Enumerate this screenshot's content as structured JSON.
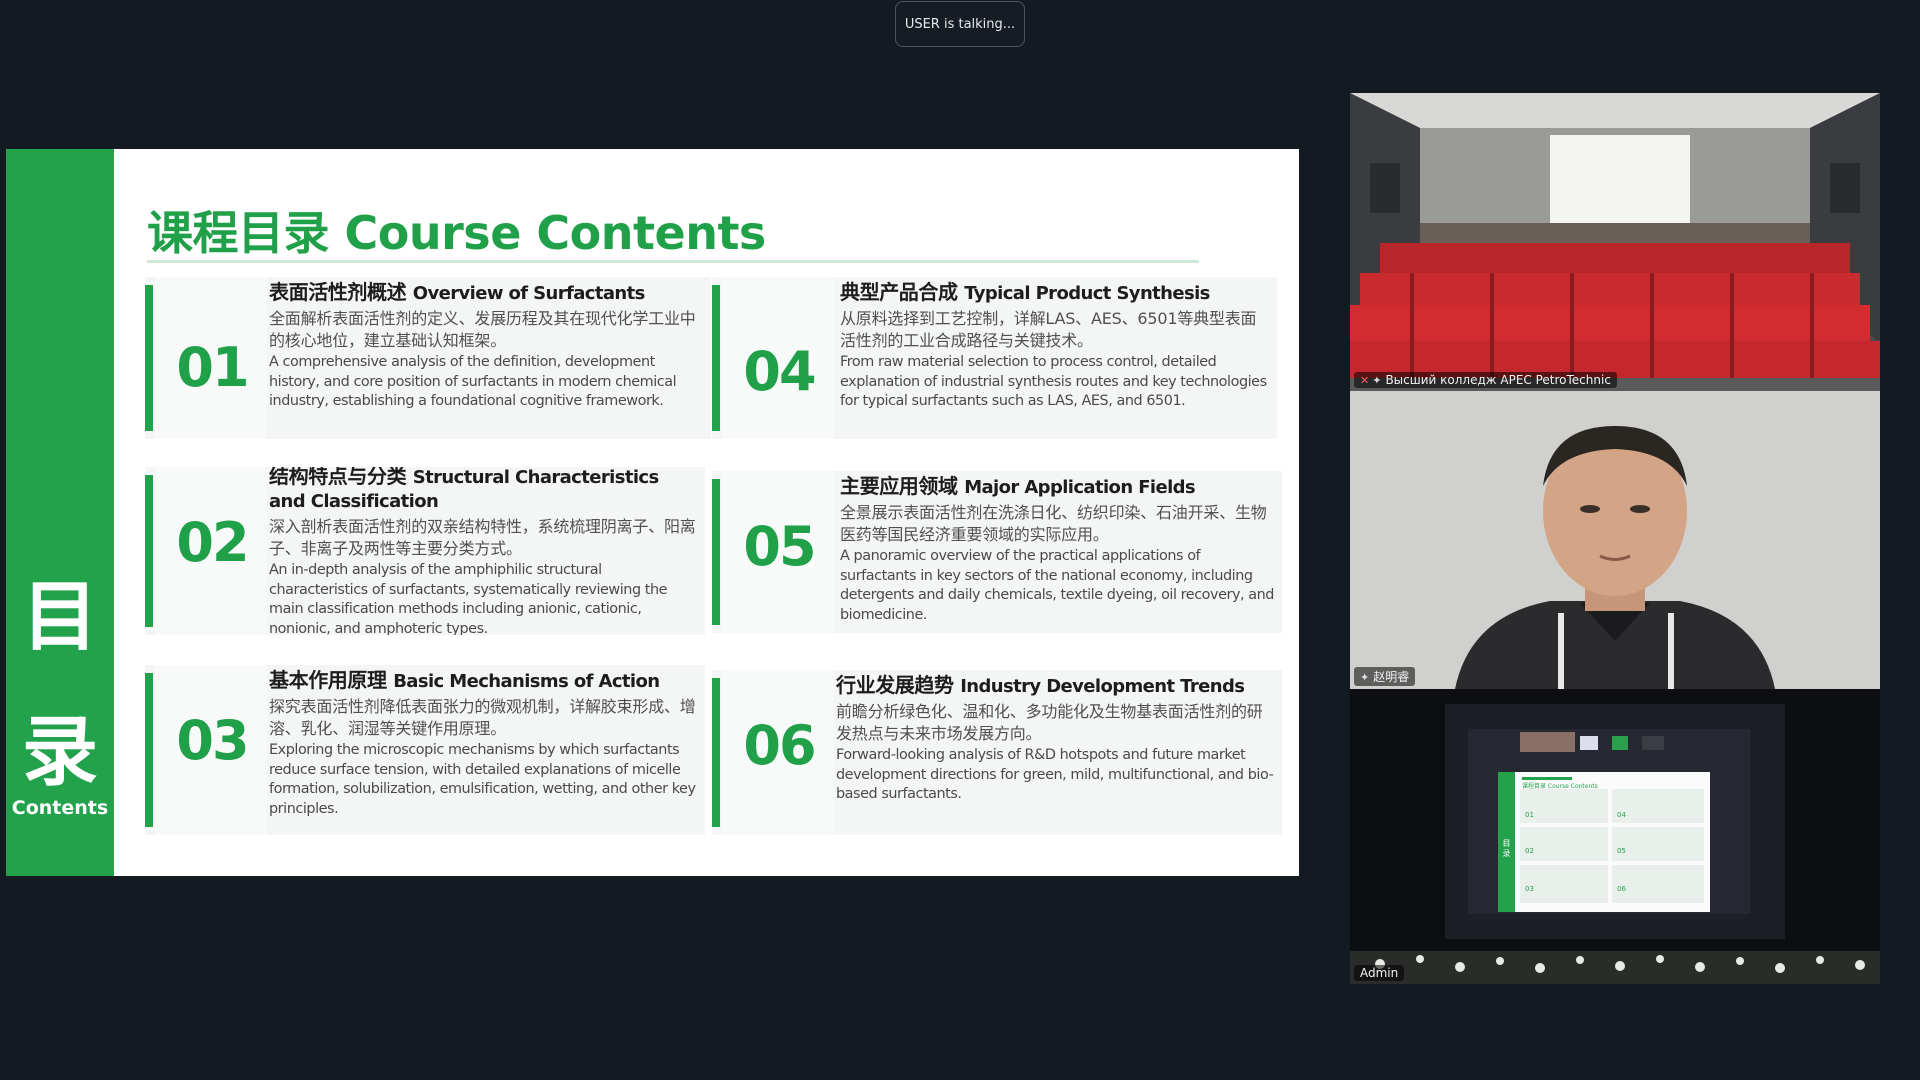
{
  "status": {
    "talking": "USER is talking..."
  },
  "slide": {
    "side_char_1": "目",
    "side_char_2": "录",
    "side_label": "Contents",
    "title": "课程目录 Course Contents",
    "items": [
      {
        "num": "01",
        "title_zh": "表面活性剂概述",
        "title_en": "Overview of Surfactants",
        "desc_zh": "全面解析表面活性剂的定义、发展历程及其在现代化学工业中的核心地位，建立基础认知框架。",
        "desc_en": "A comprehensive analysis of the definition, development history, and core position of surfactants in modern chemical industry, establishing a foundational cognitive framework."
      },
      {
        "num": "02",
        "title_zh": "结构特点与分类",
        "title_en": "Structural Characteristics and Classification",
        "desc_zh": "深入剖析表面活性剂的双亲结构特性，系统梳理阴离子、阳离子、非离子及两性等主要分类方式。",
        "desc_en": "An in-depth analysis of the amphiphilic structural characteristics of surfactants, systematically reviewing the main classification methods including anionic, cationic, nonionic, and amphoteric types."
      },
      {
        "num": "03",
        "title_zh": "基本作用原理",
        "title_en": "Basic Mechanisms of Action",
        "desc_zh": "探究表面活性剂降低表面张力的微观机制，详解胶束形成、增溶、乳化、润湿等关键作用原理。",
        "desc_en": "Exploring the microscopic mechanisms by which surfactants reduce surface tension, with detailed explanations of micelle formation, solubilization, emulsification, wetting, and other key principles."
      },
      {
        "num": "04",
        "title_zh": "典型产品合成",
        "title_en": "Typical Product Synthesis",
        "desc_zh": "从原料选择到工艺控制，详解LAS、AES、6501等典型表面活性剂的工业合成路径与关键技术。",
        "desc_en": "From raw material selection to process control, detailed explanation of industrial synthesis routes and key technologies for typical surfactants such as LAS, AES, and 6501."
      },
      {
        "num": "05",
        "title_zh": "主要应用领域",
        "title_en": "Major Application Fields",
        "desc_zh": "全景展示表面活性剂在洗涤日化、纺织印染、石油开采、生物医药等国民经济重要领域的实际应用。",
        "desc_en": "A panoramic overview of the practical applications of surfactants in key sectors of the national economy, including detergents and daily chemicals, textile dyeing, oil recovery, and biomedicine."
      },
      {
        "num": "06",
        "title_zh": "行业发展趋势",
        "title_en": "Industry Development Trends",
        "desc_zh": "前瞻分析绿色化、温和化、多功能化及生物基表面活性剂的研发热点与未来市场发展方向。",
        "desc_en": "Forward-looking analysis of R&D hotspots and future market development directions for green, mild, multifunctional, and bio-based surfactants."
      }
    ]
  },
  "participants": [
    {
      "name": "Высший колледж APEC PetroTechnic"
    },
    {
      "name": "赵明睿"
    },
    {
      "name": "Admin"
    }
  ],
  "thumb": {
    "title": "课程目录 Course Contents",
    "nums": [
      "01",
      "02",
      "03",
      "04",
      "05",
      "06"
    ],
    "side": "目录"
  },
  "colors": {
    "accent": "#23a24c",
    "background": "#141a21"
  }
}
